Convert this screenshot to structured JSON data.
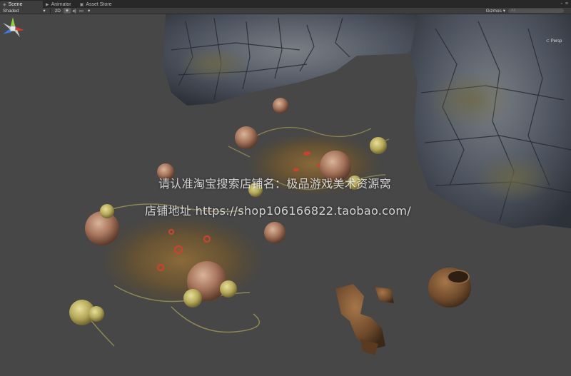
{
  "tabs": [
    {
      "icon": "scene-icon",
      "label": "Scene",
      "active": true
    },
    {
      "icon": "animator-icon",
      "label": "Animator",
      "active": false
    },
    {
      "icon": "asset-store-icon",
      "label": "Asset Store",
      "active": false
    }
  ],
  "toolbar": {
    "shading_mode": "Shaded",
    "mode_2d": "2D",
    "gizmos_label": "Gizmos",
    "search_placeholder": "All"
  },
  "gizmo": {
    "persp_label": "Persp"
  },
  "watermark": {
    "line1": "请认准淘宝搜索店铺名：极品游戏美术资源窝",
    "line2": "店铺地址 https://shop106166822.taobao.com/"
  },
  "colors": {
    "viewport_bg": "#474747",
    "toolbar_bg": "#3d3d3d",
    "tabbar_bg": "#282828",
    "gizmo_x": "#d63a2a",
    "gizmo_y": "#8fd13a",
    "gizmo_z": "#3a7ad6"
  }
}
